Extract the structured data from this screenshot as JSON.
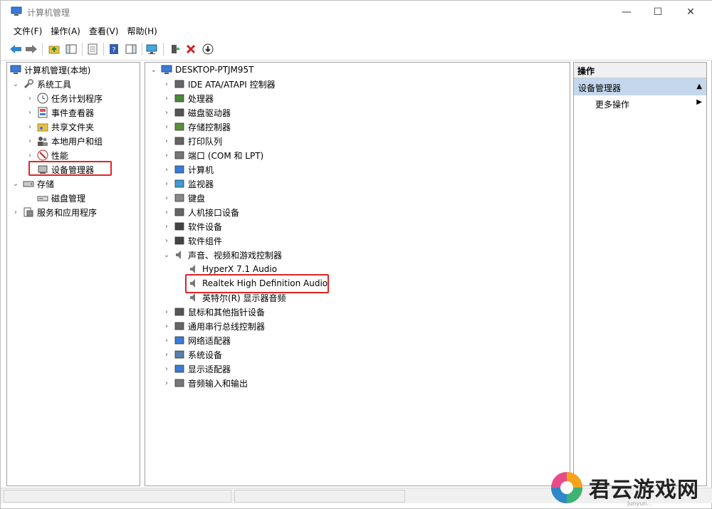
{
  "title_bar": {
    "title": "计算机管理"
  },
  "menu": [
    "文件(F)",
    "操作(A)",
    "查看(V)",
    "帮助(H)"
  ],
  "left_tree": {
    "root": "计算机管理(本地)",
    "system_tools": "系统工具",
    "task_scheduler": "任务计划程序",
    "event_viewer": "事件查看器",
    "shared_folders": "共享文件夹",
    "local_users": "本地用户和组",
    "performance": "性能",
    "device_manager": "设备管理器",
    "storage": "存储",
    "disk_management": "磁盘管理",
    "services_apps": "服务和应用程序"
  },
  "device_tree": {
    "computer": "DESKTOP-PTJM95T",
    "categories": [
      "IDE ATA/ATAPI 控制器",
      "处理器",
      "磁盘驱动器",
      "存储控制器",
      "打印队列",
      "端口 (COM 和 LPT)",
      "计算机",
      "监视器",
      "键盘",
      "人机接口设备",
      "软件设备",
      "软件组件",
      "声音、视频和游戏控制器"
    ],
    "audio_children": [
      "HyperX 7.1 Audio",
      "Realtek High Definition Audio",
      "英特尔(R) 显示器音频"
    ],
    "categories_after": [
      "鼠标和其他指针设备",
      "通用串行总线控制器",
      "网络适配器",
      "系统设备",
      "显示适配器",
      "音频输入和输出"
    ]
  },
  "actions": {
    "header": "操作",
    "section": "设备管理器",
    "more": "更多操作"
  },
  "watermark": {
    "text": "君云游戏网",
    "sub": "Junyun..."
  },
  "colors": {
    "highlight": "#e02424",
    "section_bg": "#c5d7ec"
  }
}
